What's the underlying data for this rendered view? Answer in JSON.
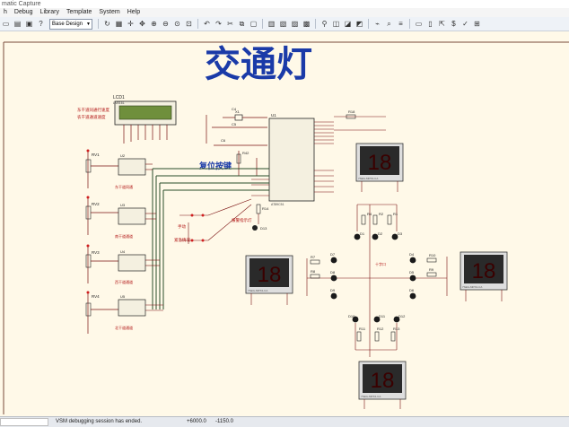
{
  "window": {
    "title": "matic Capture"
  },
  "menu": [
    "h",
    "Debug",
    "Library",
    "Template",
    "System",
    "Help"
  ],
  "toolbar": {
    "design_select": "Base Design"
  },
  "schematic": {
    "title": "交通灯",
    "reset_label": "复位按键",
    "lcd": {
      "ref": "LCD1",
      "part": "LM016L"
    },
    "lcd_labels": [
      "东干道同通行速度",
      "农干道通道速度"
    ],
    "mcu": {
      "ref": "U1",
      "part": "AT89C51"
    },
    "crystal": {
      "ref": "X1"
    },
    "caps": [
      "C4",
      "C5",
      "C6"
    ],
    "resistors": [
      "R42",
      "R18",
      "R4",
      "R2",
      "R1",
      "R14",
      "R7",
      "R8",
      "R10",
      "R9",
      "R11",
      "R12",
      "R13"
    ],
    "pots": [
      "RV1",
      "RV2",
      "RV3",
      "RV4"
    ],
    "adcs": [
      "U2",
      "U3",
      "U4",
      "U5"
    ],
    "adc_labels": [
      "东干道同通",
      "南干道通道",
      "西干道通道",
      "北干道通道"
    ],
    "switch_labels": [
      "手动",
      "紧急情况"
    ],
    "led_label": "报警指示灯",
    "led_ref": "D13",
    "center_label": "十字口",
    "leds": [
      "D1",
      "D2",
      "D3",
      "D4",
      "D5",
      "D6",
      "D7",
      "D8",
      "D9",
      "D10",
      "D11",
      "D12"
    ],
    "seg_part": "7SEG-MPX2-CA",
    "seg_digits": "18"
  },
  "status": {
    "message": "VSM debugging session has ended.",
    "x": "+6000.0",
    "y": "-1150.0"
  },
  "colors": {
    "wire": "#7a1010",
    "bus": "#2a4d2a",
    "background": "#fff9e8",
    "title": "#1a3aa8"
  }
}
